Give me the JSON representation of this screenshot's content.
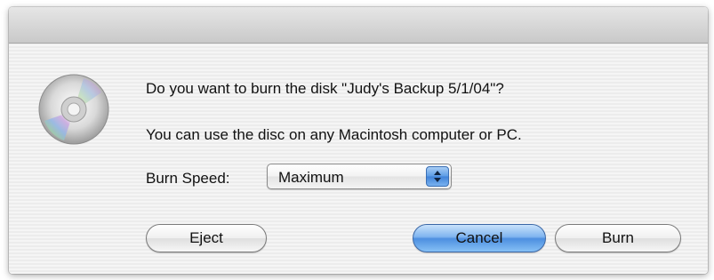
{
  "dialog": {
    "icon": "cd-disc-icon",
    "question": "Do you want to burn the disk \"Judy's Backup 5/1/04\"?",
    "info": "You can use the disc on any Macintosh computer or PC.",
    "burn_speed": {
      "label": "Burn Speed:",
      "selected": "Maximum"
    },
    "buttons": {
      "eject": "Eject",
      "cancel": "Cancel",
      "burn": "Burn"
    }
  },
  "colors": {
    "default_button": "#4d8fe0",
    "popup_stepper": "#5a9be6",
    "dialog_background": "#ececec"
  }
}
